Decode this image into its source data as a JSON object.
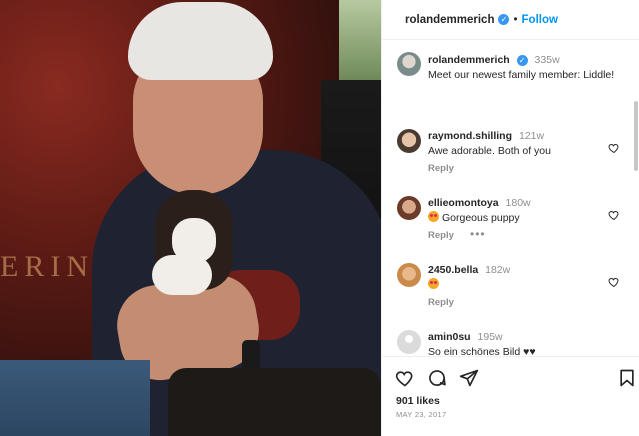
{
  "header": {
    "username": "rolandemmerich",
    "separator": "•",
    "follow_label": "Follow"
  },
  "photo": {
    "poster_text": "ERIN"
  },
  "caption": {
    "username": "rolandemmerich",
    "time": "335w",
    "text": "Meet our newest family member: Liddle!"
  },
  "comments": [
    {
      "username": "raymond.shilling",
      "time": "121w",
      "text": "Awe adorable. Both of you",
      "reply_label": "Reply"
    },
    {
      "username": "ellieomontoya",
      "time": "180w",
      "text": "Gorgeous puppy",
      "reply_label": "Reply",
      "more": "•••"
    },
    {
      "username": "2450.bella",
      "time": "182w",
      "text": "",
      "reply_label": "Reply"
    },
    {
      "username": "amin0su",
      "time": "195w",
      "text": "So ein schönes Bild ♥♥"
    }
  ],
  "actions": {
    "likes": "901 likes",
    "date": "MAY 23, 2017"
  },
  "colors": {
    "accent": "#0095f6",
    "verified": "#3897f0",
    "muted": "#8e8e8e",
    "text": "#262626"
  },
  "icons": [
    "heart-icon",
    "comment-icon",
    "share-icon",
    "bookmark-icon",
    "verified-icon",
    "more-icon"
  ]
}
